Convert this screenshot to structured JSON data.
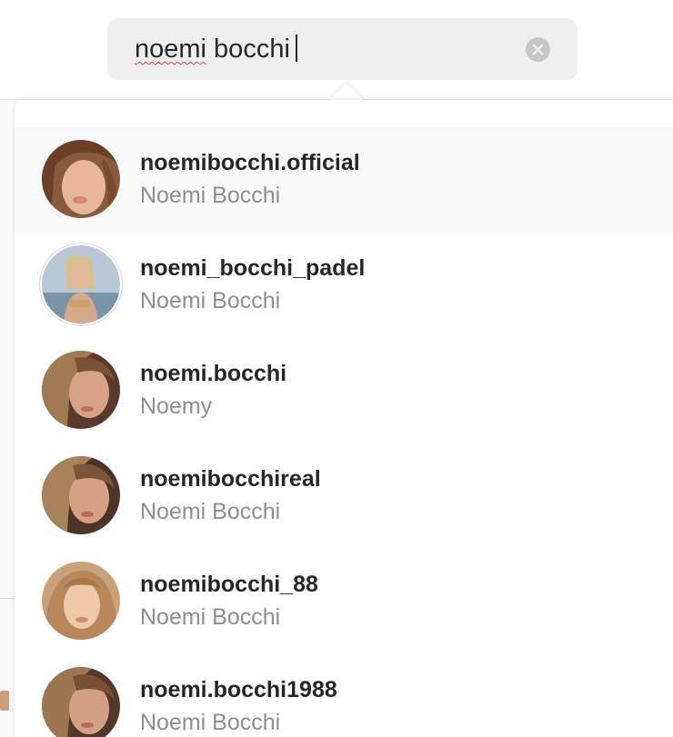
{
  "search": {
    "query_part1": "noemi",
    "query_part2": " bocchi",
    "clear_icon": "clear-circle-x-icon"
  },
  "colors": {
    "username": "#262626",
    "fullname": "#8e8e8e",
    "field_bg": "#efefef",
    "highlight_bg": "#fafafa"
  },
  "results": [
    {
      "username": "noemibocchi.official",
      "full_name": "Noemi Bocchi",
      "avatar": "profile-photo"
    },
    {
      "username": "noemi_bocchi_padel",
      "full_name": "Noemi Bocchi",
      "avatar": "profile-photo"
    },
    {
      "username": "noemi.bocchi",
      "full_name": "Noemy",
      "avatar": "profile-photo"
    },
    {
      "username": "noemibocchireal",
      "full_name": "Noemi Bocchi",
      "avatar": "profile-photo"
    },
    {
      "username": "noemibocchi_88",
      "full_name": "Noemi Bocchi",
      "avatar": "profile-photo"
    },
    {
      "username": "noemi.bocchi1988",
      "full_name": "Noemi Bocchi",
      "avatar": "profile-photo"
    }
  ]
}
